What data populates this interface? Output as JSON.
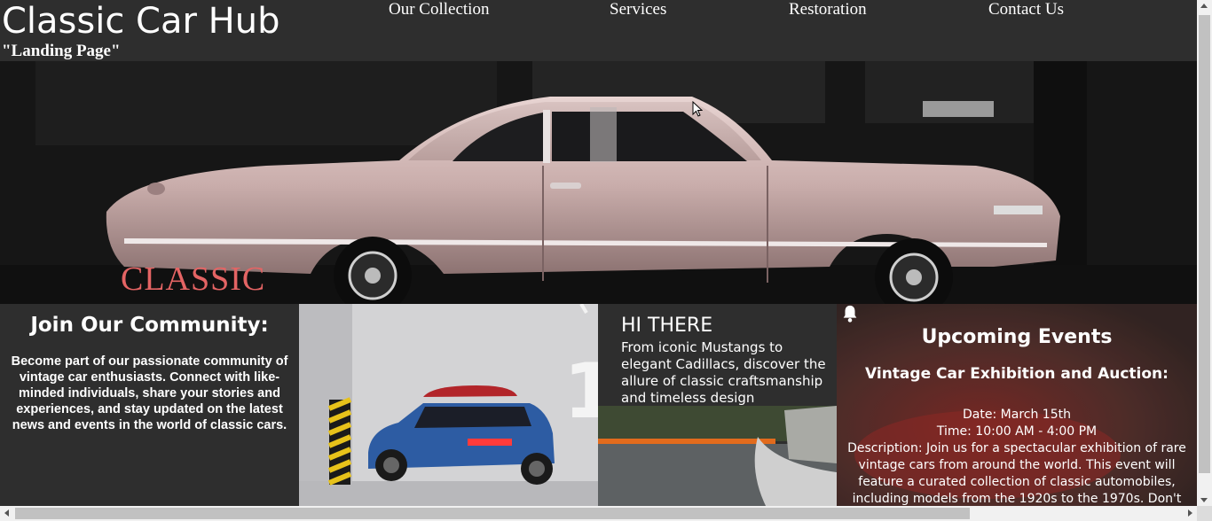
{
  "header": {
    "title": "Classic Car Hub",
    "subtitle": "\"Landing Page\"",
    "nav": [
      {
        "label": "Our Collection"
      },
      {
        "label": "Services"
      },
      {
        "label": "Restoration"
      },
      {
        "label": "Contact Us"
      }
    ]
  },
  "hero": {
    "caption": "CLASSIC",
    "image_icon": "classic-car-photo"
  },
  "community": {
    "title": "Join Our Community:",
    "text": "Become part of our passionate community of vintage car enthusiasts. Connect with like-minded individuals, share your stories and experiences, and stay updated on the latest news and events in the world of classic cars."
  },
  "greeting": {
    "title": "HI THERE",
    "text": "From iconic Mustangs to elegant Cadillacs, discover the allure of classic craftsmanship and timeless design"
  },
  "events": {
    "title": "Upcoming Events",
    "icon": "bell-icon",
    "subtitle": "Vintage Car Exhibition and Auction:",
    "date": "Date: March 15th",
    "time": "Time: 10:00 AM - 4:00 PM",
    "description": "Description: Join us for a spectacular exhibition of rare vintage cars from around the world. This event will feature a curated collection of classic automobiles, including models from the 1920s to the 1970s. Don't miss the chance to bid on your"
  },
  "colors": {
    "page_background": "#2e2e2e",
    "text": "#ffffff",
    "hero_caption": "#e46464"
  }
}
